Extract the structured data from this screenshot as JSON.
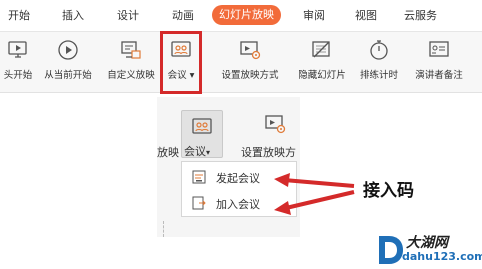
{
  "tabs": [
    {
      "label": "开始"
    },
    {
      "label": "插入"
    },
    {
      "label": "设计"
    },
    {
      "label": "动画"
    },
    {
      "label": "幻灯片放映",
      "active": true
    },
    {
      "label": "审阅"
    },
    {
      "label": "视图"
    },
    {
      "label": "云服务"
    }
  ],
  "ribbon": {
    "from_start": "头开始",
    "from_current": "从当前开始",
    "custom_show": "自定义放映",
    "meeting": "会议",
    "setup_show": "设置放映方式",
    "hide_slide": "隐藏幻灯片",
    "rehearse": "排练计时",
    "presenter_notes": "演讲者备注"
  },
  "panel": {
    "show_partial": "放映",
    "meeting_label": "会议",
    "setup_partial": "设置放映方"
  },
  "dropdown": {
    "start_meeting": "发起会议",
    "join_meeting": "加入会议"
  },
  "annotation": "接入码",
  "watermark": {
    "text": "大湖网",
    "url": "dahu123.com"
  },
  "colors": {
    "accent": "#f26b3a",
    "highlight_red": "#d42a2a"
  }
}
